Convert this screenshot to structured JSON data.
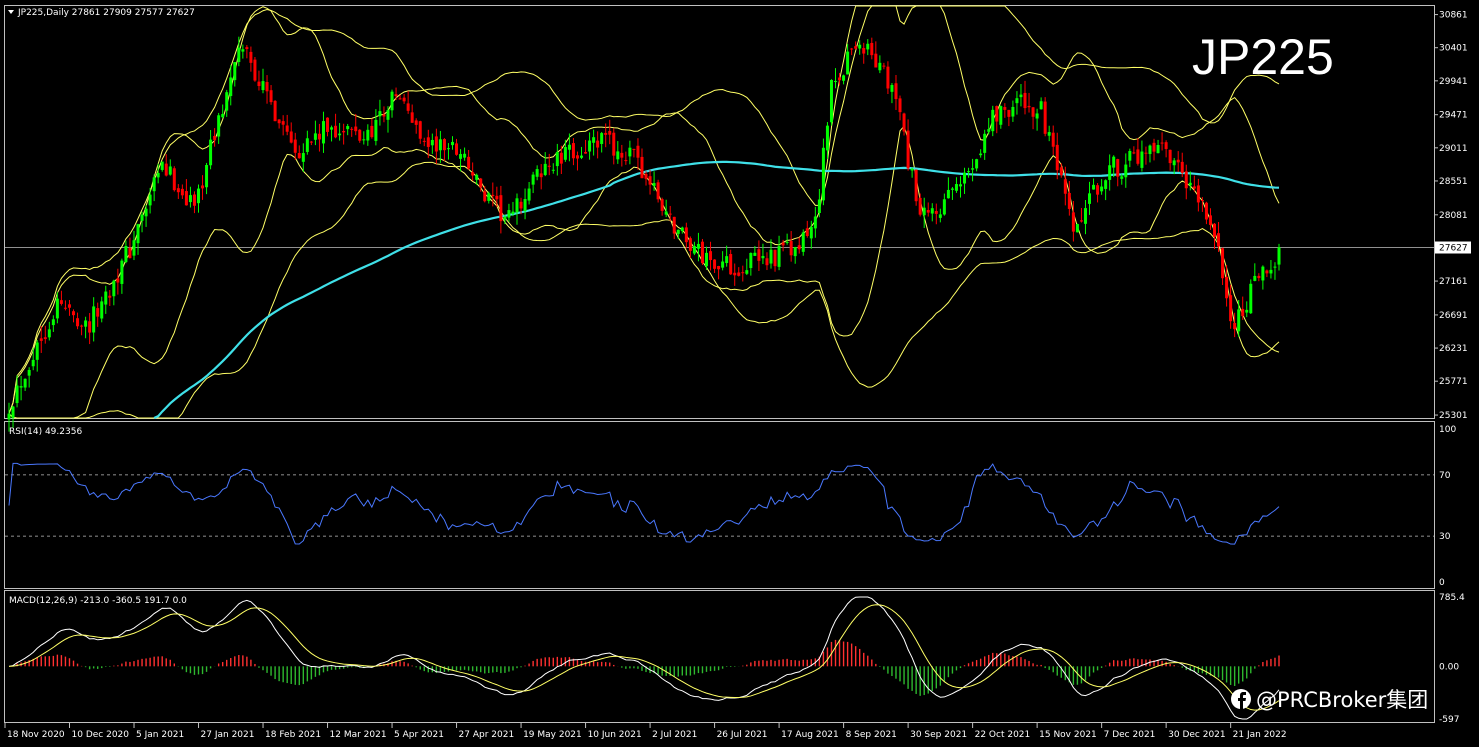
{
  "header": {
    "symbol_line": "JP225,Daily  27861 27909 27577 27627",
    "big_title": "JP225"
  },
  "watermark": "@PRCBroker集团",
  "colors": {
    "background": "#000000",
    "frame": "#c0c0c0",
    "bull_candle": "#00ff00",
    "bear_candle": "#ff0000",
    "bollinger": "#ffff66",
    "ma": "#3fe0e8",
    "rsi_line": "#4a78ff",
    "macd_main": "#ffffff",
    "macd_signal": "#ffff66",
    "hist_pos": "#ff3030",
    "hist_neg": "#2eb82e"
  },
  "icons": {
    "watermark": "facebook-icon",
    "symbol_dropdown": "triangle-down-icon"
  },
  "chart_data": {
    "type": "candlestick",
    "price_axis": {
      "ticks": [
        "30861",
        "30401",
        "29941",
        "29471",
        "29011",
        "28551",
        "28081",
        "27627",
        "27161",
        "26691",
        "26231",
        "25771",
        "25301"
      ],
      "tick_values": [
        30861,
        30401,
        29941,
        29471,
        29011,
        28551,
        28081,
        27627,
        27161,
        26691,
        26231,
        25771,
        25301
      ],
      "current": 27627,
      "ylim": [
        25260,
        30980
      ]
    },
    "x_axis": {
      "labels": [
        "18 Nov 2020",
        "10 Dec 2020",
        "5 Jan 2021",
        "27 Jan 2021",
        "18 Feb 2021",
        "12 Mar 2021",
        "5 Apr 2021",
        "27 Apr 2021",
        "19 May 2021",
        "10 Jun 2021",
        "2 Jul 2021",
        "26 Jul 2021",
        "17 Aug 2021",
        "8 Sep 2021",
        "30 Sep 2021",
        "22 Oct 2021",
        "15 Nov 2021",
        "7 Dec 2021",
        "30 Dec 2021",
        "21 Jan 2022"
      ],
      "label_bars": [
        0,
        16,
        32,
        48,
        64,
        80,
        96,
        112,
        128,
        144,
        160,
        176,
        192,
        208,
        224,
        240,
        256,
        272,
        288,
        304
      ],
      "bar_count": 316
    },
    "ohlc_keypoints": [
      [
        0,
        25450
      ],
      [
        12,
        26850
      ],
      [
        20,
        26550
      ],
      [
        30,
        27600
      ],
      [
        38,
        28750
      ],
      [
        46,
        28200
      ],
      [
        52,
        29400
      ],
      [
        58,
        30450
      ],
      [
        64,
        29700
      ],
      [
        72,
        29000
      ],
      [
        80,
        29300
      ],
      [
        88,
        29150
      ],
      [
        96,
        29750
      ],
      [
        104,
        29050
      ],
      [
        112,
        29000
      ],
      [
        118,
        28300
      ],
      [
        124,
        28000
      ],
      [
        132,
        28700
      ],
      [
        140,
        28950
      ],
      [
        148,
        29100
      ],
      [
        156,
        28800
      ],
      [
        164,
        28000
      ],
      [
        172,
        27500
      ],
      [
        180,
        27350
      ],
      [
        188,
        27500
      ],
      [
        196,
        27600
      ],
      [
        200,
        28000
      ],
      [
        204,
        29800
      ],
      [
        210,
        30500
      ],
      [
        214,
        30300
      ],
      [
        220,
        29700
      ],
      [
        226,
        28000
      ],
      [
        232,
        28200
      ],
      [
        238,
        28700
      ],
      [
        244,
        29450
      ],
      [
        250,
        29650
      ],
      [
        256,
        29500
      ],
      [
        260,
        28700
      ],
      [
        264,
        27800
      ],
      [
        272,
        28700
      ],
      [
        280,
        28850
      ],
      [
        286,
        28950
      ],
      [
        292,
        28500
      ],
      [
        298,
        28000
      ],
      [
        304,
        26500
      ],
      [
        308,
        27000
      ],
      [
        312,
        27300
      ],
      [
        315,
        27627
      ]
    ],
    "overlays": [
      "Bollinger Bands (20,2)",
      "Bollinger Bands (wide)",
      "Moving Average (cyan)"
    ],
    "rsi": {
      "label": "RSI(14) 49.2356",
      "levels": [
        "100",
        "70",
        "30",
        "0"
      ],
      "level_values": [
        100,
        70,
        30,
        0
      ]
    },
    "macd": {
      "label": "MACD(12,26,9) -213.0 -360.5 191.7 0.0",
      "ticks": [
        "785.4",
        "0.00",
        "-597"
      ],
      "tick_values": [
        785.4,
        0,
        -597
      ]
    }
  }
}
